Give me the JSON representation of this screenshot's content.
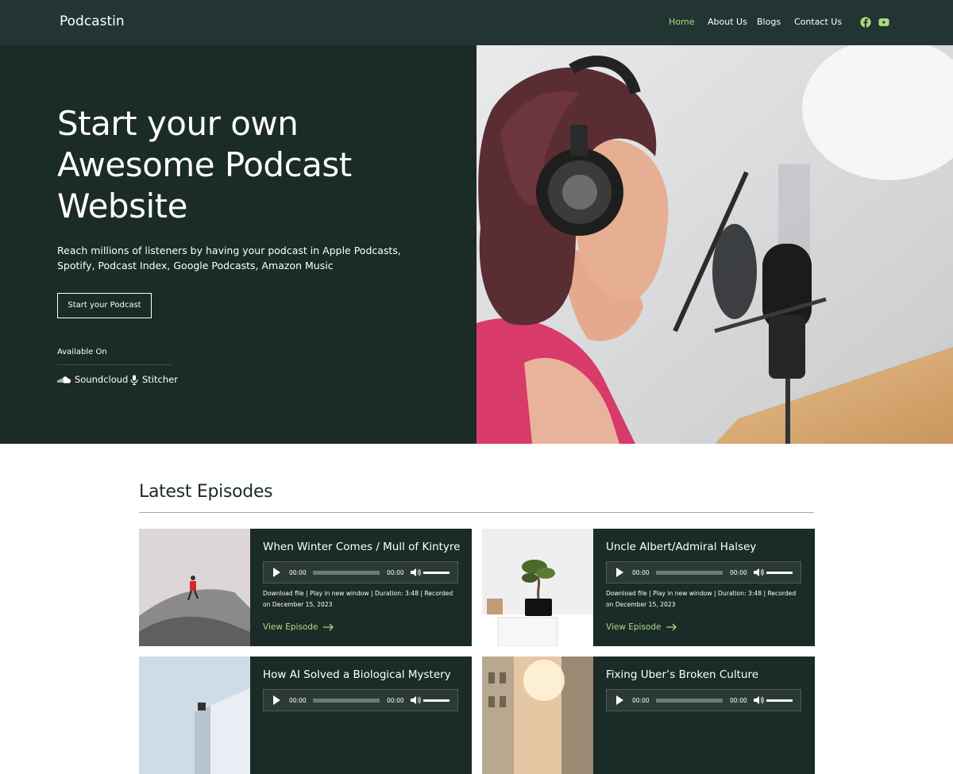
{
  "header": {
    "logo": "Podcastin",
    "nav": [
      "Home",
      "About Us",
      "Blogs",
      "Contact Us"
    ],
    "active_nav": "Home",
    "social_icons": [
      "facebook-icon",
      "youtube-icon"
    ],
    "accent_color": "#a9dd83"
  },
  "hero": {
    "title": "Start your own Awesome Podcast Website",
    "subtitle": "Reach millions of listeners by having your podcast in Apple Podcasts, Spotify, Podcast Index, Google Podcasts, Amazon Music",
    "button_label": "Start your Podcast",
    "available_label": "Available On",
    "platforms": [
      "Soundcloud",
      "Stitcher"
    ]
  },
  "episodes": {
    "section_title": "Latest Episodes",
    "items": [
      {
        "title": "When Winter Comes / Mull of Kintyre",
        "time_current": "00:00",
        "time_total": "00:00",
        "download": "Download file",
        "play_new": "Play in new window",
        "duration": "Duration: 3:48",
        "recorded": "Recorded on December 15, 2023",
        "view_label": "View Episode"
      },
      {
        "title": "Uncle Albert/Admiral Halsey",
        "time_current": "00:00",
        "time_total": "00:00",
        "download": "Download file",
        "play_new": "Play in new window",
        "duration": "Duration: 3:48",
        "recorded": "Recorded on December 15, 2023",
        "view_label": "View Episode"
      },
      {
        "title": "How AI Solved a Biological Mystery",
        "time_current": "00:00",
        "time_total": "00:00"
      },
      {
        "title": "Fixing Uber’s Broken Culture",
        "time_current": "00:00",
        "time_total": "00:00"
      }
    ]
  }
}
